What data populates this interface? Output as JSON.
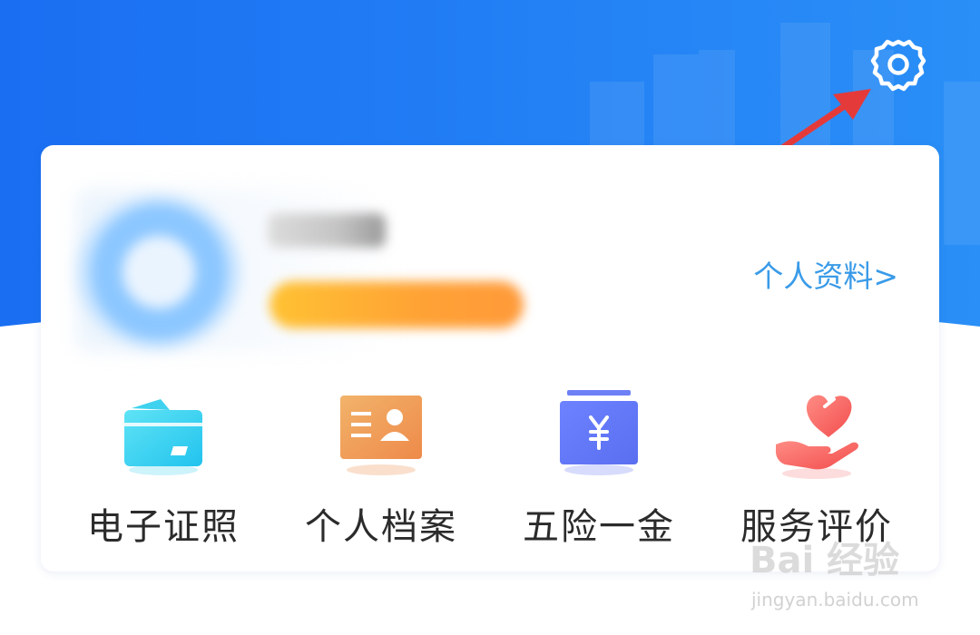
{
  "header": {
    "settings_icon": "gear-icon",
    "accent_color": "#1e7ff0"
  },
  "profile": {
    "name": "",
    "link_label": "个人资料>"
  },
  "services": [
    {
      "label": "电子证照",
      "icon": "e-license-card-icon"
    },
    {
      "label": "个人档案",
      "icon": "personal-file-icon"
    },
    {
      "label": "五险一金",
      "icon": "insurance-yuan-icon"
    },
    {
      "label": "服务评价",
      "icon": "service-rating-heart-hand-icon"
    }
  ],
  "annotation": {
    "arrow_color": "#e53a3a"
  },
  "watermark": {
    "brand": "Bai 经验",
    "url": "jingyan.baidu.com"
  }
}
